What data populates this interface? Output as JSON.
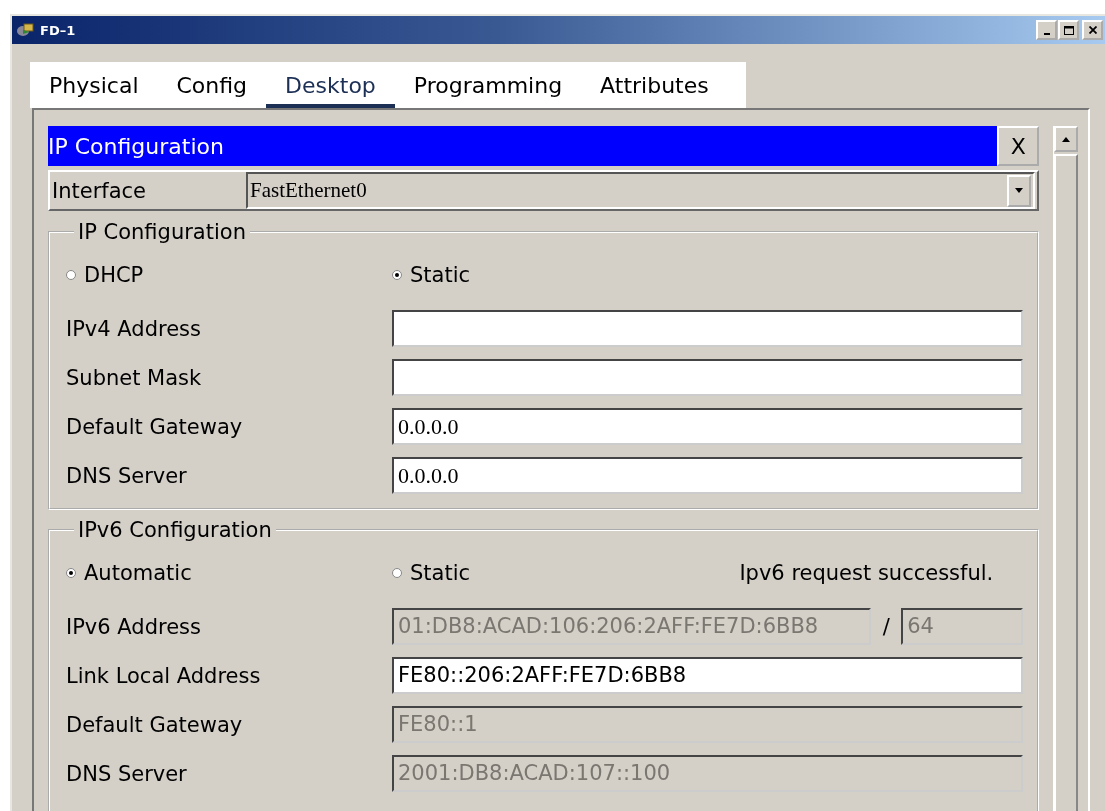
{
  "window": {
    "title": "FD–1"
  },
  "tabs": [
    {
      "label": "Physical",
      "selected": false
    },
    {
      "label": "Config",
      "selected": false
    },
    {
      "label": "Desktop",
      "selected": true
    },
    {
      "label": "Programming",
      "selected": false
    },
    {
      "label": "Attributes",
      "selected": false
    }
  ],
  "panel": {
    "title": "IP Configuration",
    "close": "X"
  },
  "interface": {
    "label": "Interface",
    "value": "FastEthernet0"
  },
  "ipv4": {
    "title": "IP Configuration",
    "modes": [
      {
        "label": "DHCP",
        "selected": false
      },
      {
        "label": "Static",
        "selected": true
      }
    ],
    "fields": [
      {
        "kind": "text",
        "label": "IPv4 Address",
        "disabled": false
      },
      {
        "kind": "text",
        "label": "Subnet Mask",
        "disabled": false
      },
      {
        "kind": "text",
        "label": "Default Gateway",
        "value": "0.0.0.0",
        "disabled": false
      },
      {
        "kind": "text",
        "label": "DNS Server",
        "value": "0.0.0.0",
        "disabled": false
      }
    ]
  },
  "ipv6": {
    "title": "IPv6 Configuration",
    "modes": [
      {
        "label": "Automatic",
        "selected": true
      },
      {
        "label": "Static",
        "selected": false
      }
    ],
    "status": "Ipv6 request successful.",
    "fields": [
      {
        "kind": "prefix",
        "label": "IPv6 Address",
        "value": "01:DB8:ACAD:106:206:2AFF:FE7D:6BB8",
        "separator": "/",
        "prefix": "64",
        "disabled": true
      },
      {
        "kind": "text",
        "label": "Link Local Address",
        "value": "FE80::206:2AFF:FE7D:6BB8",
        "disabled": false
      },
      {
        "kind": "text",
        "label": "Default Gateway",
        "value": "FE80::1",
        "disabled": true
      },
      {
        "kind": "text",
        "label": "DNS Server",
        "value": "2001:DB8:ACAD:107::100",
        "disabled": true
      }
    ]
  }
}
